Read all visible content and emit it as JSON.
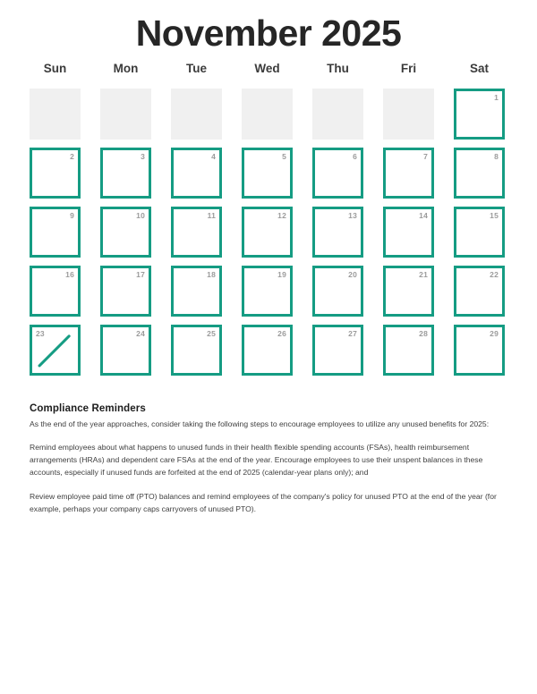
{
  "calendar": {
    "title": "November 2025",
    "weekdays": [
      "Sun",
      "Mon",
      "Tue",
      "Wed",
      "Thu",
      "Fri",
      "Sat"
    ],
    "accent_color": "#159c83",
    "empty_cell_color": "#f0f0f0",
    "day_number_color": "#9b9b9b",
    "cells": [
      {
        "label": "",
        "type": "empty"
      },
      {
        "label": "",
        "type": "empty"
      },
      {
        "label": "",
        "type": "empty"
      },
      {
        "label": "",
        "type": "empty"
      },
      {
        "label": "",
        "type": "empty"
      },
      {
        "label": "",
        "type": "empty"
      },
      {
        "label": "1",
        "type": "day"
      },
      {
        "label": "2",
        "type": "day"
      },
      {
        "label": "3",
        "type": "day"
      },
      {
        "label": "4",
        "type": "day"
      },
      {
        "label": "5",
        "type": "day"
      },
      {
        "label": "6",
        "type": "day"
      },
      {
        "label": "7",
        "type": "day"
      },
      {
        "label": "8",
        "type": "day"
      },
      {
        "label": "9",
        "type": "day"
      },
      {
        "label": "10",
        "type": "day"
      },
      {
        "label": "11",
        "type": "day"
      },
      {
        "label": "12",
        "type": "day"
      },
      {
        "label": "13",
        "type": "day"
      },
      {
        "label": "14",
        "type": "day"
      },
      {
        "label": "15",
        "type": "day"
      },
      {
        "label": "16",
        "type": "day"
      },
      {
        "label": "17",
        "type": "day"
      },
      {
        "label": "18",
        "type": "day"
      },
      {
        "label": "19",
        "type": "day"
      },
      {
        "label": "20",
        "type": "day"
      },
      {
        "label": "21",
        "type": "day"
      },
      {
        "label": "22",
        "type": "day"
      },
      {
        "label": "23",
        "type": "crossed"
      },
      {
        "label": "24",
        "type": "day"
      },
      {
        "label": "25",
        "type": "day"
      },
      {
        "label": "26",
        "type": "day"
      },
      {
        "label": "27",
        "type": "day"
      },
      {
        "label": "28",
        "type": "day"
      },
      {
        "label": "29",
        "type": "day"
      }
    ]
  },
  "notes": {
    "heading": "Compliance Reminders",
    "paragraphs": [
      "As the end of the year approaches, consider taking the following steps to encourage employees to utilize any unused benefits for 2025:",
      "Remind employees about what happens to unused funds in their health flexible spending accounts (FSAs), health reimbursement arrangements (HRAs) and dependent care FSAs at the end of the year. Encourage employees to use their unspent balances in these accounts, especially if unused funds are forfeited at the end of 2025 (calendar-year plans only); and",
      "Review employee paid time off (PTO) balances and remind employees of the company's policy for unused PTO at the end of the year (for example, perhaps your company caps carryovers of unused PTO)."
    ]
  }
}
